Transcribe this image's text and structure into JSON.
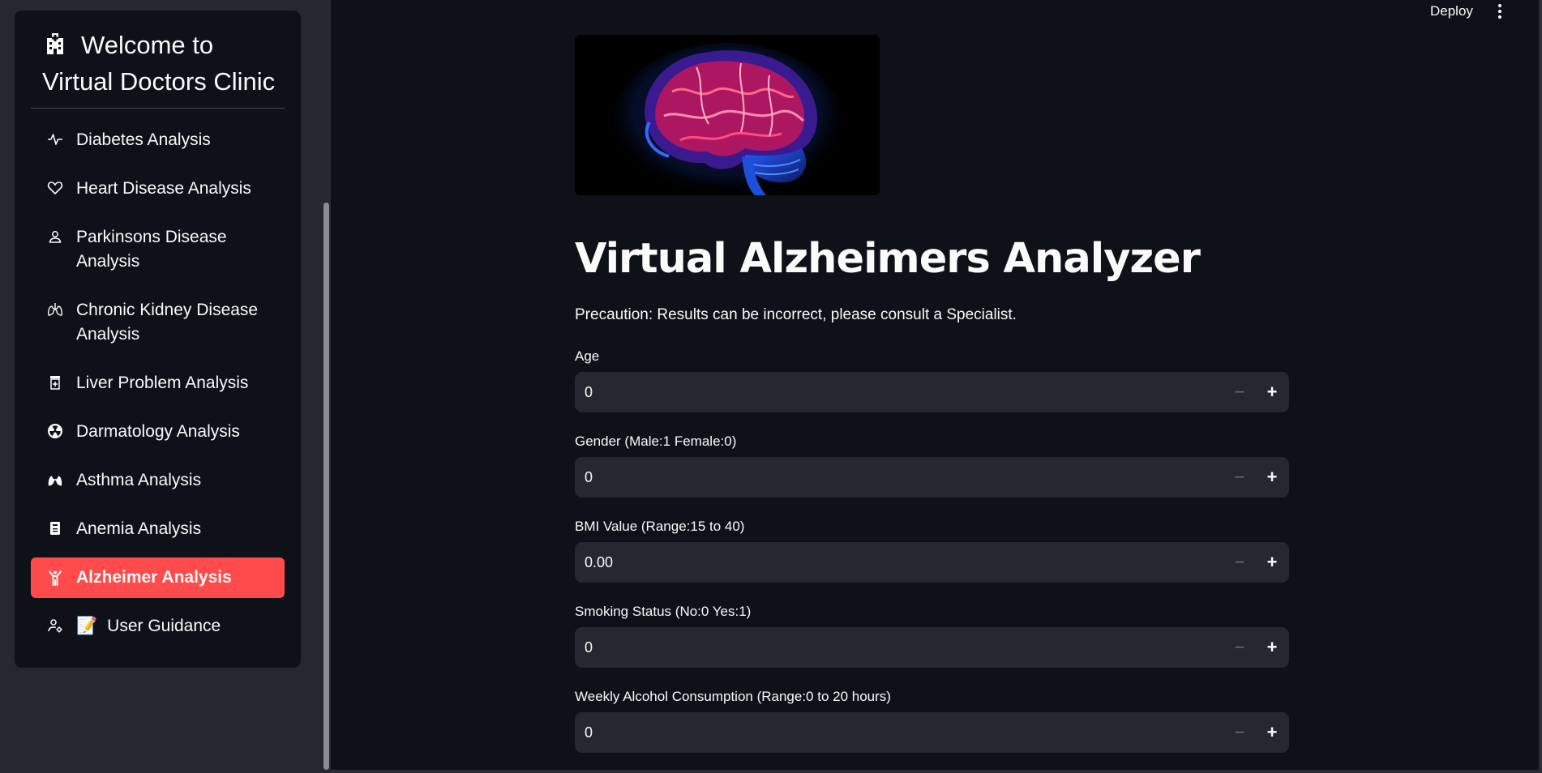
{
  "sidebar": {
    "title_line1": "Welcome to",
    "title_line2": "Virtual Doctors Clinic",
    "title_icon": "hospital-icon",
    "items": [
      {
        "label": "Diabetes Analysis",
        "icon": "activity-icon"
      },
      {
        "label": "Heart Disease Analysis",
        "icon": "heart-icon"
      },
      {
        "label": "Parkinsons Disease Analysis",
        "icon": "person-icon"
      },
      {
        "label": "Chronic Kidney Disease Analysis",
        "icon": "lungs-icon"
      },
      {
        "label": "Liver Problem Analysis",
        "icon": "prescription-icon"
      },
      {
        "label": "Darmatology Analysis",
        "icon": "radioactive-icon"
      },
      {
        "label": "Asthma Analysis",
        "icon": "lungs-fill-icon"
      },
      {
        "label": "Anemia Analysis",
        "icon": "clipboard-icon"
      },
      {
        "label": "Alzheimer Analysis",
        "icon": "person-raised-hands-icon",
        "active": true
      },
      {
        "label": "User Guidance",
        "icon": "person-gear-icon",
        "emoji": "📝"
      }
    ],
    "active_color": "#ff4b4b"
  },
  "header": {
    "deploy_label": "Deploy",
    "menu_icon": "kebab-menu-icon"
  },
  "main": {
    "title": "Virtual Alzheimers Analyzer",
    "precaution": "Precaution: Results can be incorrect, please consult a Specialist.",
    "fields": [
      {
        "label": "Age",
        "value": "0"
      },
      {
        "label": "Gender (Male:1 Female:0)",
        "value": "0"
      },
      {
        "label": "BMI Value (Range:15 to 40)",
        "value": "0.00"
      },
      {
        "label": "Smoking Status (No:0 Yes:1)",
        "value": "0"
      },
      {
        "label": "Weekly Alcohol Consumption (Range:0 to 20 hours)",
        "value": "0"
      }
    ],
    "stepper_minus": "−",
    "stepper_plus": "+"
  }
}
